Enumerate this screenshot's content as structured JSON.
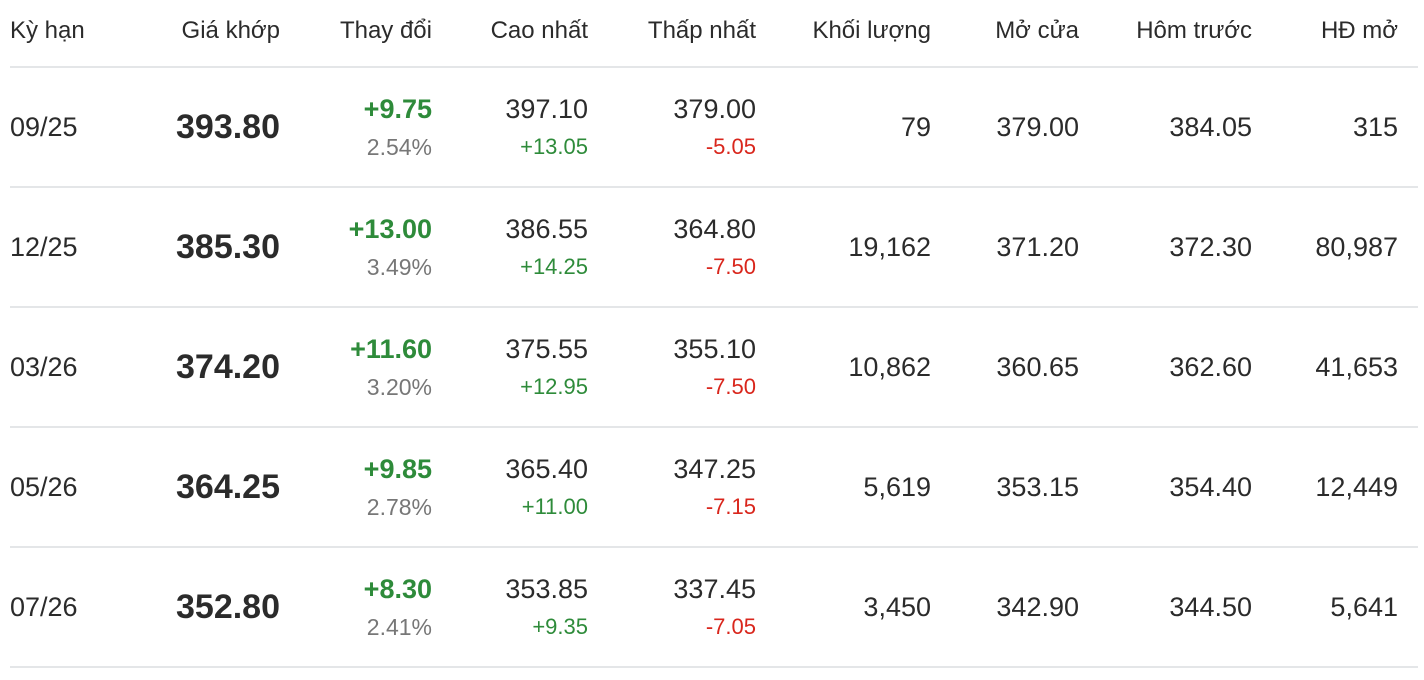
{
  "colors": {
    "up": "#2e8b3a",
    "down": "#d9261c"
  },
  "headers": [
    "Kỳ hạn",
    "Giá khớp",
    "Thay đổi",
    "Cao nhất",
    "Thấp nhất",
    "Khối lượng",
    "Mở cửa",
    "Hôm trước",
    "HĐ mở"
  ],
  "rows": [
    {
      "term": "09/25",
      "price": "393.80",
      "change": "+9.75",
      "change_pct": "2.54%",
      "high": "397.10",
      "high_diff": "+13.05",
      "low": "379.00",
      "low_diff": "-5.05",
      "volume": "79",
      "open": "379.00",
      "prev": "384.05",
      "oi": "315"
    },
    {
      "term": "12/25",
      "price": "385.30",
      "change": "+13.00",
      "change_pct": "3.49%",
      "high": "386.55",
      "high_diff": "+14.25",
      "low": "364.80",
      "low_diff": "-7.50",
      "volume": "19,162",
      "open": "371.20",
      "prev": "372.30",
      "oi": "80,987"
    },
    {
      "term": "03/26",
      "price": "374.20",
      "change": "+11.60",
      "change_pct": "3.20%",
      "high": "375.55",
      "high_diff": "+12.95",
      "low": "355.10",
      "low_diff": "-7.50",
      "volume": "10,862",
      "open": "360.65",
      "prev": "362.60",
      "oi": "41,653"
    },
    {
      "term": "05/26",
      "price": "364.25",
      "change": "+9.85",
      "change_pct": "2.78%",
      "high": "365.40",
      "high_diff": "+11.00",
      "low": "347.25",
      "low_diff": "-7.15",
      "volume": "5,619",
      "open": "353.15",
      "prev": "354.40",
      "oi": "12,449"
    },
    {
      "term": "07/26",
      "price": "352.80",
      "change": "+8.30",
      "change_pct": "2.41%",
      "high": "353.85",
      "high_diff": "+9.35",
      "low": "337.45",
      "low_diff": "-7.05",
      "volume": "3,450",
      "open": "342.90",
      "prev": "344.50",
      "oi": "5,641"
    }
  ]
}
